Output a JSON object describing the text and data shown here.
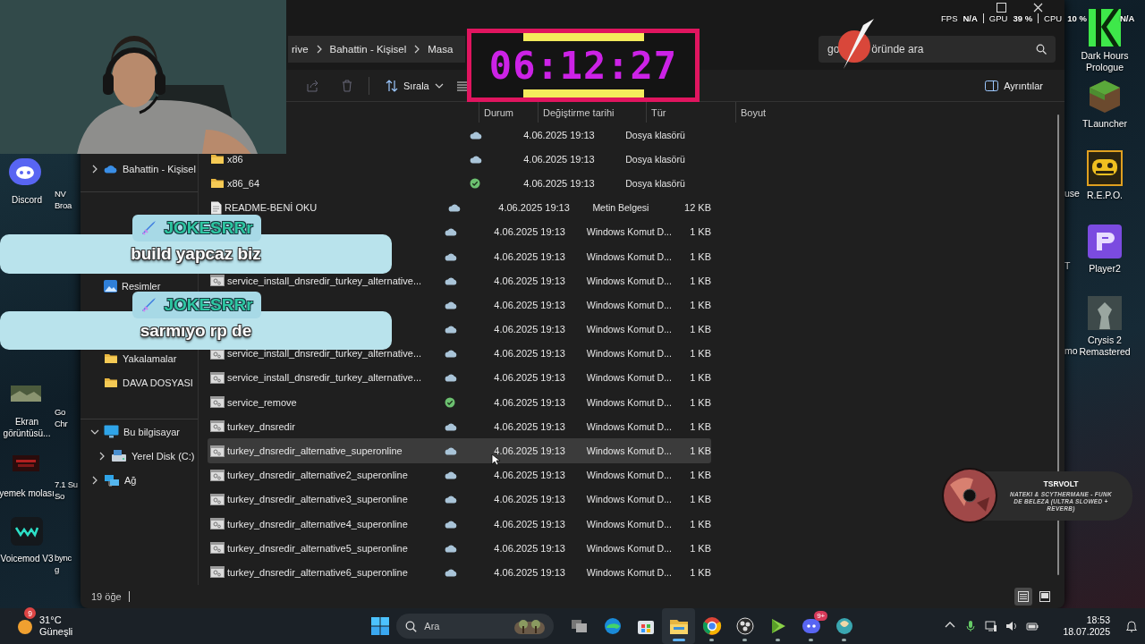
{
  "timer": {
    "text": "06:12:27"
  },
  "perf_overlay": {
    "items": [
      {
        "label": "FPS",
        "value": "N/A"
      },
      {
        "label": "GPU",
        "value": "39 %"
      },
      {
        "label": "CPU",
        "value": "10 %"
      }
    ],
    "trailing": "N/A"
  },
  "desktop": {
    "left_icons": [
      {
        "kind": "discord",
        "lines": [
          "Discord"
        ]
      },
      {
        "kind": "screenshot",
        "lines": [
          "Ekran",
          "görüntüsü..."
        ]
      },
      {
        "kind": "red",
        "lines": [
          "yemek molası"
        ]
      },
      {
        "kind": "voicemod",
        "lines": [
          "Voicemod V3"
        ]
      }
    ],
    "left_cut_labels": [
      [
        "NV",
        "Broa"
      ],
      [
        "Go",
        "Chr"
      ],
      [
        "7.1 Su",
        "So"
      ],
      [
        "bync",
        "g"
      ]
    ],
    "right_icons": [
      {
        "kind": "green-k",
        "lines": [
          "Dark Hours",
          "Prologue"
        ]
      },
      {
        "kind": "block",
        "lines": [
          "TLauncher"
        ]
      },
      {
        "kind": "robot",
        "lines": [
          "R.E.P.O."
        ]
      },
      {
        "kind": "purple",
        "lines": [
          "Player2"
        ]
      },
      {
        "kind": "soldier",
        "lines": [
          "Crysis 2",
          "Remastered"
        ]
      }
    ],
    "right_cut_labels": [
      "use",
      "T",
      "mo"
    ]
  },
  "explorer": {
    "breadcrumb": [
      "rive",
      "Bahattin - Kişisel",
      "Masa"
    ],
    "search": {
      "text_parts": [
        "go",
        "öründe ara"
      ]
    },
    "toolbar": {
      "sort_label": "Sırala",
      "details_label": "Ayrıntılar"
    },
    "nav_sections": [
      [
        {
          "label": "Bahattin - Kişisel",
          "kind": "cloud",
          "expanded": false
        }
      ],
      [
        {
          "label": "Resimler",
          "kind": "pictures"
        }
      ],
      [
        {
          "label": "Yakalamalar",
          "kind": "folder"
        },
        {
          "label": "DAVA DOSYASI",
          "kind": "folder"
        }
      ],
      [
        {
          "label": "Bu bilgisayar",
          "kind": "pc",
          "expanded": true,
          "children": [
            {
              "label": "Yerel Disk (C:)",
              "kind": "disk",
              "expanded": false
            }
          ]
        },
        {
          "label": "Ağ",
          "kind": "network",
          "expanded": false
        }
      ]
    ],
    "columns": [
      "Durum",
      "Değiştirme tarihi",
      "Tür",
      "Boyut"
    ],
    "files": [
      {
        "synced": false,
        "modified": "4.06.2025 19:13",
        "type": "Dosya klasörü",
        "selected": false
      },
      {
        "name": "x86",
        "kind": "folder",
        "synced": false,
        "modified": "4.06.2025 19:13",
        "type": "Dosya klasörü",
        "selected": false
      },
      {
        "name": "x86_64",
        "kind": "folder",
        "synced": true,
        "modified": "4.06.2025 19:13",
        "type": "Dosya klasörü",
        "selected": false
      },
      {
        "name": "README-BENİ OKU",
        "kind": "text",
        "synced": false,
        "modified": "4.06.2025 19:13",
        "type": "Metin Belgesi",
        "size": "12 KB",
        "selected": false
      },
      {
        "synced": false,
        "modified": "4.06.2025 19:13",
        "type": "Windows Komut D...",
        "size": "1 KB",
        "selected": false
      },
      {
        "synced": false,
        "modified": "4.06.2025 19:13",
        "type": "Windows Komut D...",
        "size": "1 KB",
        "selected": false
      },
      {
        "name": "service_install_dnsredir_turkey_alternative...",
        "kind": "script",
        "synced": false,
        "modified": "4.06.2025 19:13",
        "type": "Windows Komut D...",
        "size": "1 KB",
        "selected": false
      },
      {
        "synced": false,
        "modified": "4.06.2025 19:13",
        "type": "Windows Komut D...",
        "size": "1 KB",
        "selected": false
      },
      {
        "synced": false,
        "modified": "4.06.2025 19:13",
        "type": "Windows Komut D...",
        "size": "1 KB",
        "selected": false
      },
      {
        "name": "service_install_dnsredir_turkey_alternative...",
        "kind": "script",
        "synced": false,
        "modified": "4.06.2025 19:13",
        "type": "Windows Komut D...",
        "size": "1 KB",
        "selected": false
      },
      {
        "name": "service_install_dnsredir_turkey_alternative...",
        "kind": "script",
        "synced": false,
        "modified": "4.06.2025 19:13",
        "type": "Windows Komut D...",
        "size": "1 KB",
        "selected": false
      },
      {
        "name": "service_remove",
        "kind": "script",
        "synced": true,
        "modified": "4.06.2025 19:13",
        "type": "Windows Komut D...",
        "size": "1 KB",
        "selected": false
      },
      {
        "name": "turkey_dnsredir",
        "kind": "script",
        "synced": false,
        "modified": "4.06.2025 19:13",
        "type": "Windows Komut D...",
        "size": "1 KB",
        "selected": false
      },
      {
        "name": "turkey_dnsredir_alternative_superonline",
        "kind": "script",
        "synced": false,
        "modified": "4.06.2025 19:13",
        "type": "Windows Komut D...",
        "size": "1 KB",
        "selected": true
      },
      {
        "name": "turkey_dnsredir_alternative2_superonline",
        "kind": "script",
        "synced": false,
        "modified": "4.06.2025 19:13",
        "type": "Windows Komut D...",
        "size": "1 KB",
        "selected": false
      },
      {
        "name": "turkey_dnsredir_alternative3_superonline",
        "kind": "script",
        "synced": false,
        "modified": "4.06.2025 19:13",
        "type": "Windows Komut D...",
        "size": "1 KB",
        "selected": false
      },
      {
        "name": "turkey_dnsredir_alternative4_superonline",
        "kind": "script",
        "synced": false,
        "modified": "4.06.2025 19:13",
        "type": "Windows Komut D...",
        "size": "1 KB",
        "selected": false
      },
      {
        "name": "turkey_dnsredir_alternative5_superonline",
        "kind": "script",
        "synced": false,
        "modified": "4.06.2025 19:13",
        "type": "Windows Komut D...",
        "size": "1 KB",
        "selected": false
      },
      {
        "name": "turkey_dnsredir_alternative6_superonline",
        "kind": "script",
        "synced": false,
        "modified": "4.06.2025 19:13",
        "type": "Windows Komut D...",
        "size": "1 KB",
        "selected": false
      }
    ],
    "status_bar": {
      "count": "19 öğe"
    },
    "views": [
      {
        "kind": "details",
        "selected": true
      },
      {
        "kind": "tiles",
        "selected": false
      }
    ]
  },
  "chat": [
    {
      "user": "JOKESRRr",
      "text": "build yapcaz biz"
    },
    {
      "user": "JOKESRRr",
      "text": "sarmıyo rp de"
    }
  ],
  "now_playing": {
    "artist": "TSRVOLT",
    "title": "NATEKI & SCYTHERMANE - FUNK DE BELEZA (ULTRA SLOWED + REVERB)"
  },
  "taskbar": {
    "weather": {
      "badge": "9",
      "temp": "31°C",
      "desc": "Güneşli"
    },
    "search_placeholder": "Ara",
    "apps": [
      {
        "kind": "taskview",
        "running": false,
        "active": false
      },
      {
        "kind": "edge",
        "running": false,
        "active": false
      },
      {
        "kind": "store",
        "running": false,
        "active": false
      },
      {
        "kind": "explorer",
        "running": true,
        "active": true
      },
      {
        "kind": "chrome",
        "running": true,
        "active": false
      },
      {
        "kind": "obs",
        "running": true,
        "active": false
      },
      {
        "kind": "play",
        "running": true,
        "active": false
      },
      {
        "kind": "discord",
        "running": true,
        "active": false,
        "badge": "9+"
      },
      {
        "kind": "app",
        "running": true,
        "active": false
      }
    ],
    "time": "18:53",
    "date": "18.07.2025"
  }
}
